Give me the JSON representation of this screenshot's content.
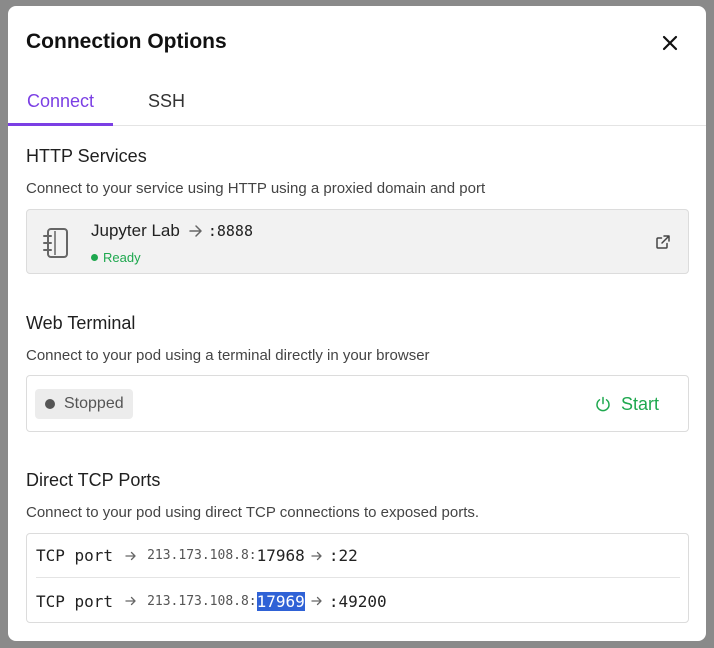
{
  "modal": {
    "title": "Connection Options"
  },
  "tabs": [
    {
      "label": "Connect",
      "active": true
    },
    {
      "label": "SSH",
      "active": false
    }
  ],
  "http": {
    "title": "HTTP Services",
    "description": "Connect to your service using HTTP using a proxied domain and port",
    "service": {
      "name": "Jupyter Lab",
      "port": ":8888",
      "status": "Ready",
      "status_color": "#1fa84f"
    }
  },
  "terminal": {
    "title": "Web Terminal",
    "description": "Connect to your pod using a terminal directly in your browser",
    "status": "Stopped",
    "start_label": "Start"
  },
  "tcp": {
    "title": "Direct TCP Ports",
    "description": "Connect to your pod using direct TCP connections to exposed ports.",
    "ports": [
      {
        "label": "TCP port",
        "ip": "213.173.108.8:",
        "external": "17968",
        "internal": ":22"
      },
      {
        "label": "TCP port",
        "ip": "213.173.108.8:",
        "external": "17969",
        "internal": ":49200"
      }
    ]
  },
  "colors": {
    "accent": "#7b3fe4",
    "success": "#1fa84f",
    "selection": "#2f62d6"
  }
}
